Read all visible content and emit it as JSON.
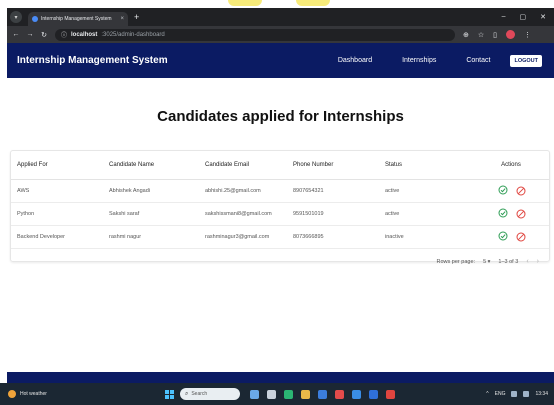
{
  "browser": {
    "tab_title": "Internship Management System",
    "tab_close": "×",
    "new_tab": "+",
    "url_host": "localhost",
    "url_path": ":3025/admin-dashboard"
  },
  "navbar": {
    "brand": "Internship Management System",
    "links": [
      "Dashboard",
      "Internships",
      "Contact"
    ],
    "logout_label": "LOGOUT"
  },
  "page": {
    "heading": "Candidates applied for Internships"
  },
  "table": {
    "columns": [
      "Applied For",
      "Candidate Name",
      "Candidate Email",
      "Phone Number",
      "Status",
      "Actions"
    ],
    "rows": [
      {
        "applied_for": "AWS",
        "name": "Abhishek Angadi",
        "email": "abhishi.25@gmail.com",
        "phone": "8907654321",
        "status": "active"
      },
      {
        "applied_for": "Python",
        "name": "Sakshi saraf",
        "email": "sakshissmani8@gmail.com",
        "phone": "9591501019",
        "status": "active"
      },
      {
        "applied_for": "Backend Developer",
        "name": "rashmi nagur",
        "email": "rashminagur3@gmail.com",
        "phone": "8073666895",
        "status": "inactive"
      }
    ],
    "accept_color": "#2e9d55",
    "reject_color": "#e0453f"
  },
  "pagination": {
    "rows_per_page_label": "Rows per page:",
    "rows_per_page_value": "5",
    "range": "1–3 of 3"
  },
  "taskbar": {
    "weather": "Hot weather",
    "search_placeholder": "Search",
    "tray_lang": "ENG",
    "time": "13:34"
  },
  "colors": {
    "navbar": "#0b1b63",
    "taskbar": "#1b2733"
  }
}
